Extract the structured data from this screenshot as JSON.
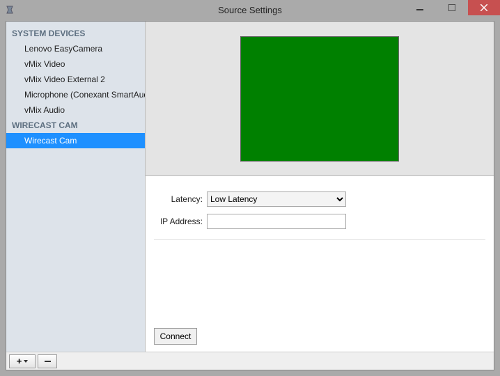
{
  "window": {
    "title": "Source Settings"
  },
  "sidebar": {
    "section1": {
      "header": "SYSTEM DEVICES",
      "items": [
        "Lenovo EasyCamera",
        "vMix Video",
        "vMix Video External 2",
        "Microphone (Conexant SmartAudi",
        "vMix Audio"
      ]
    },
    "section2": {
      "header": "WIRECAST CAM",
      "items": [
        "Wirecast Cam"
      ]
    }
  },
  "settings": {
    "latency_label": "Latency:",
    "latency_value": "Low Latency",
    "ip_label": "IP Address:",
    "ip_value": "",
    "connect_label": "Connect"
  },
  "preview": {
    "color": "#008000"
  },
  "icons": {
    "app": "app-icon",
    "minimize": "minimize-icon",
    "maximize": "maximize-icon",
    "close": "close-icon",
    "add": "plus-icon",
    "remove": "minus-icon"
  }
}
